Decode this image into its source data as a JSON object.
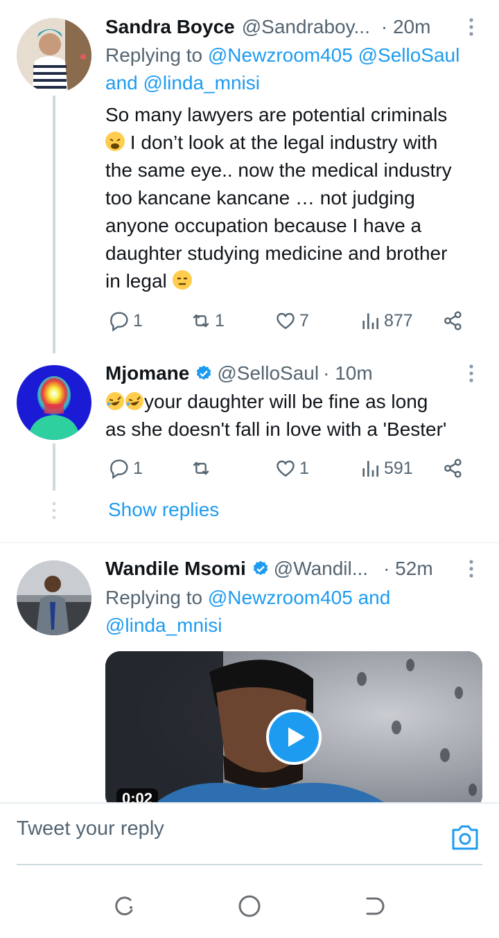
{
  "tweets": [
    {
      "name": "Sandra Boyce",
      "handle": "@Sandraboy...",
      "time": "· 20m",
      "replying_prefix": "Replying to ",
      "replying_mentions": "@Newzroom405 @SelloSaul",
      "replying_and": "and ",
      "replying_last": "@linda_mnisi",
      "text_lines": [
        "So many lawyers are potential criminals",
        " I don’t look at the legal industry with",
        "the same eye.. now the medical industry",
        "too kancane kancane … not judging",
        "anyone occupation because I have a",
        "daughter studying medicine and brother",
        "in legal "
      ],
      "emoji": [
        "weary-face-emoji",
        "expressionless-face-emoji"
      ],
      "actions": {
        "replies": "1",
        "retweets": "1",
        "likes": "7",
        "views": "877"
      }
    },
    {
      "name": "Mjomane",
      "verified": true,
      "handle": "@SelloSaul",
      "time": "· 10m",
      "text_lines": [
        "your daughter will be fine as long",
        "as she doesn't fall in love with a 'Bester'"
      ],
      "emoji": [
        "rofl-emoji",
        "rofl-emoji"
      ],
      "actions": {
        "replies": "1",
        "retweets": "",
        "likes": "1",
        "views": "591"
      }
    },
    {
      "name": "Wandile Msomi",
      "verified": true,
      "handle": "@Wandil...",
      "time": "· 52m",
      "replying_prefix": "Replying to ",
      "replying_mentions": "@Newzroom405",
      "replying_and": " and",
      "replying_last": "@linda_mnisi",
      "video_time": "0:02"
    }
  ],
  "show_replies": "Show replies",
  "reply_placeholder": "Tweet your reply",
  "colors": {
    "accent": "#1d9bf0",
    "text": "#0f1419",
    "secondary": "#536471",
    "line": "#cfd9de"
  },
  "icons": [
    "reply-icon",
    "retweet-icon",
    "like-icon",
    "views-icon",
    "share-icon",
    "more-icon",
    "verified-icon",
    "camera-icon",
    "play-icon",
    "nav-recent-icon",
    "nav-home-icon",
    "nav-back-icon"
  ]
}
